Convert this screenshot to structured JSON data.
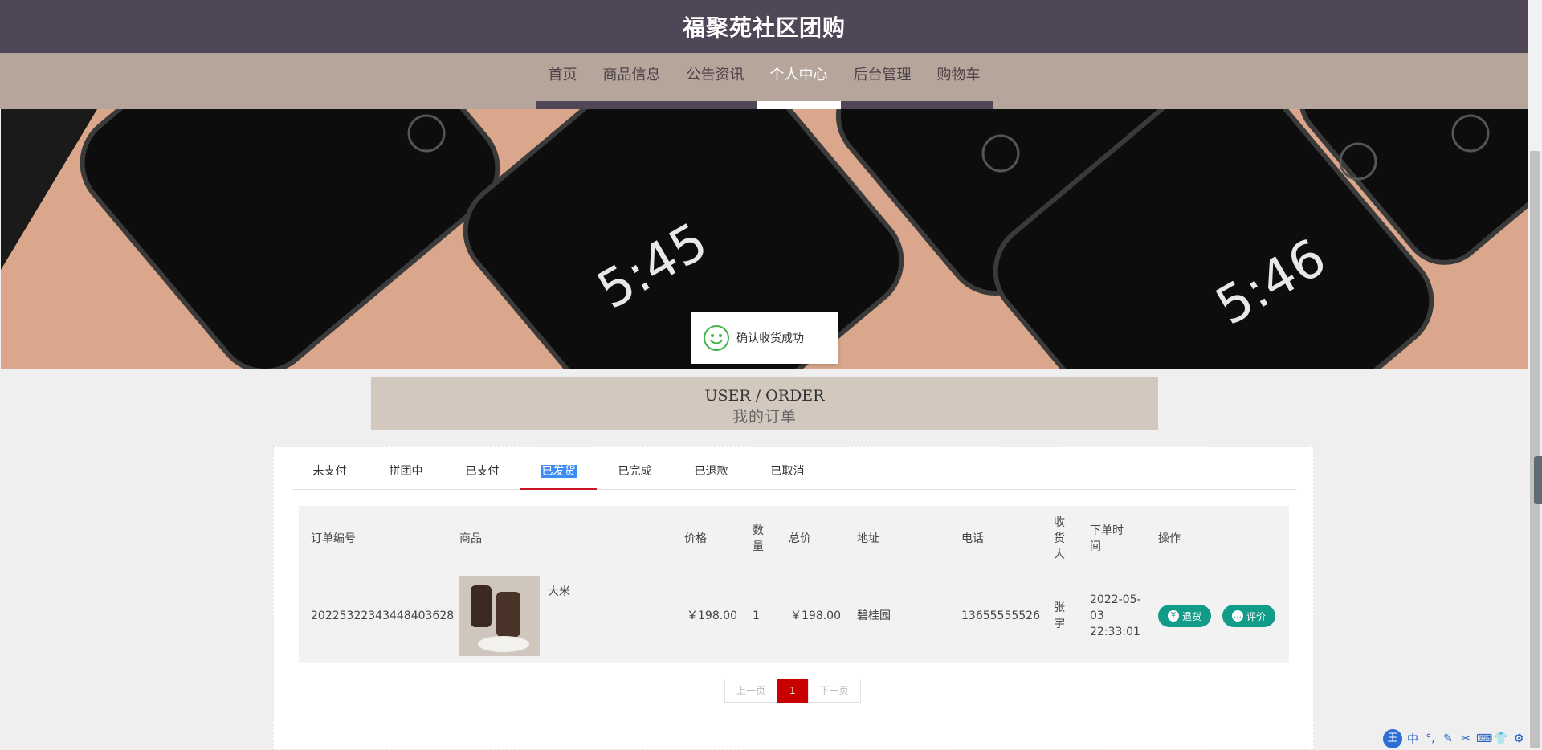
{
  "header": {
    "title": "福聚苑社区团购"
  },
  "nav": [
    {
      "label": "首页",
      "active": false
    },
    {
      "label": "商品信息",
      "active": false
    },
    {
      "label": "公告资讯",
      "active": false
    },
    {
      "label": "个人中心",
      "active": true
    },
    {
      "label": "后台管理",
      "active": false
    },
    {
      "label": "购物车",
      "active": false
    }
  ],
  "toast": {
    "message": "确认收货成功",
    "icon": "smile-icon"
  },
  "order_section": {
    "title_en": "USER / ORDER",
    "title_cn": "我的订单"
  },
  "tabs": [
    {
      "label": "未支付"
    },
    {
      "label": "拼团中"
    },
    {
      "label": "已支付"
    },
    {
      "label": "已发货",
      "active": true
    },
    {
      "label": "已完成"
    },
    {
      "label": "已退款"
    },
    {
      "label": "已取消"
    }
  ],
  "table": {
    "headers": [
      "订单编号",
      "商品",
      "价格",
      "数量",
      "总价",
      "地址",
      "电话",
      "收货人",
      "下单时间",
      "操作"
    ],
    "row": {
      "order_no": "20225322343448403628",
      "product": "大米",
      "price": "￥198.00",
      "qty": "1",
      "total": "￥198.00",
      "address": "碧桂园",
      "phone": "13655555526",
      "receiver": "张宇",
      "time": "2022-05-03 22:33:01",
      "refund_label": "退货",
      "review_label": "评价"
    }
  },
  "pager": {
    "prev": "上一页",
    "current": "1",
    "next": "下一页"
  },
  "ime": {
    "logo": "王",
    "items": [
      "中",
      "°,",
      "✎",
      "✂",
      "⌨",
      "👕",
      "⚙"
    ]
  },
  "colors": {
    "header": "#4f4757",
    "nav": "#b5a59b",
    "accent": "#c81623",
    "button": "#119c8a"
  }
}
